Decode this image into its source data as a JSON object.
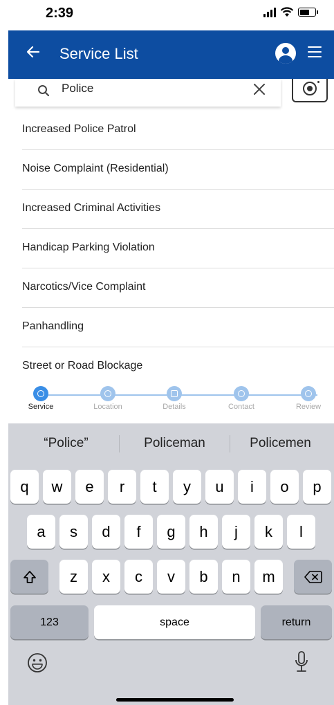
{
  "status_bar": {
    "time": "2:39"
  },
  "header": {
    "title": "Service List"
  },
  "search": {
    "query": "Police"
  },
  "services": [
    "Increased Police Patrol",
    "Noise Complaint (Residential)",
    "Increased Criminal Activities",
    "Handicap Parking Violation",
    "Narcotics/Vice Complaint",
    "Panhandling",
    "Street or Road Blockage"
  ],
  "stepper": {
    "steps": [
      "Service",
      "Location",
      "Details",
      "Contact",
      "Review"
    ],
    "active": "Service"
  },
  "keyboard": {
    "suggestions": [
      "“Police”",
      "Policeman",
      "Policemen"
    ],
    "row1": [
      "q",
      "w",
      "e",
      "r",
      "t",
      "y",
      "u",
      "i",
      "o",
      "p"
    ],
    "row2": [
      "a",
      "s",
      "d",
      "f",
      "g",
      "h",
      "j",
      "k",
      "l"
    ],
    "row3": [
      "z",
      "x",
      "c",
      "v",
      "b",
      "n",
      "m"
    ],
    "numbers_key": "123",
    "space_key": "space",
    "return_key": "return"
  },
  "colors": {
    "header": "#0d4da1",
    "step_active": "#3a8ee6",
    "step_inactive": "#9fc4ec"
  }
}
